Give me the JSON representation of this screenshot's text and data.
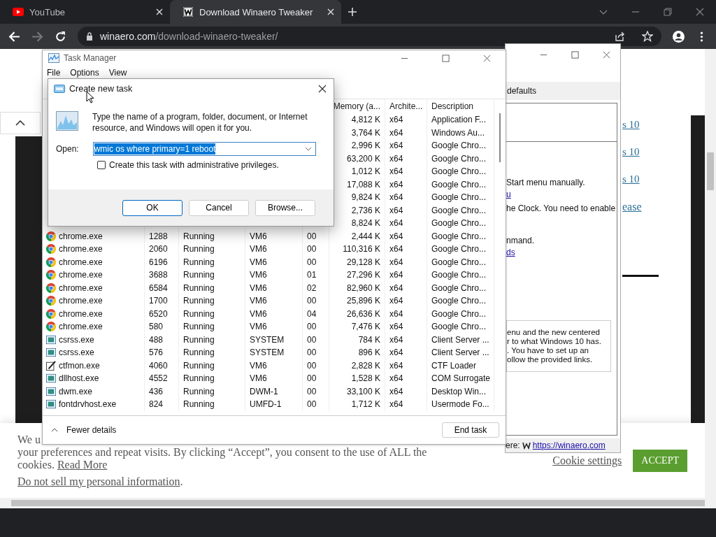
{
  "browser": {
    "tabs": [
      {
        "title": "YouTube",
        "selected": false
      },
      {
        "title": "Download Winaero Tweaker",
        "selected": true
      }
    ],
    "address": {
      "host": "winaero.com",
      "path": "/download-winaero-tweaker/"
    }
  },
  "page": {
    "links": [
      "s 10",
      "s 10",
      "s 10",
      "ease"
    ],
    "cookie_bar": {
      "line_1": "We u",
      "line_2": "your preferences and repeat visits. By clicking “Accept”, you consent to the use of ALL the",
      "line_3": {
        "before": "cookies. ",
        "link": "Read More"
      },
      "line_4": {
        "link": "Do not sell my personal information",
        "after": "."
      },
      "settings": "Cookie settings",
      "accept": "ACCEPT"
    }
  },
  "tweaker_window": {
    "tab": "defaults",
    "lines": [
      {
        "text": "Start menu manually.",
        "kind": "text"
      },
      {
        "text": "u",
        "kind": "link"
      },
      {
        "text": "he Clock. You need to enable",
        "kind": "text"
      },
      {
        "text": "nmand.",
        "kind": "text"
      },
      {
        "text": "ds",
        "kind": "link"
      }
    ],
    "note": [
      "enu and the new centered",
      "r to what Windows 10 has.",
      ". You have to set up an",
      "ollow the provided links."
    ],
    "status": {
      "label": "ere:",
      "link": "https://winaero.com"
    }
  },
  "task_manager": {
    "title": "Task Manager",
    "menu": [
      "File",
      "Options",
      "View"
    ],
    "columns": [
      "Memory (a...",
      "Archite...",
      "Description"
    ],
    "rows": [
      {
        "memory": "4,812 K",
        "arch": "x64",
        "description": "Application F..."
      },
      {
        "memory": "3,764 K",
        "arch": "x64",
        "description": "Windows Au..."
      },
      {
        "memory": "2,996 K",
        "arch": "x64",
        "description": "Google Chro..."
      },
      {
        "memory": "63,200 K",
        "arch": "x64",
        "description": "Google Chro..."
      },
      {
        "memory": "1,012 K",
        "arch": "x64",
        "description": "Google Chro..."
      },
      {
        "memory": "17,088 K",
        "arch": "x64",
        "description": "Google Chro..."
      },
      {
        "memory": "9,824 K",
        "arch": "x64",
        "description": "Google Chro..."
      },
      {
        "memory": "2,736 K",
        "arch": "x64",
        "description": "Google Chro..."
      },
      {
        "memory": "8,824 K",
        "arch": "x64",
        "description": "Google Chro..."
      },
      {
        "kind": "chrome",
        "name": "chrome.exe",
        "pid": "1288",
        "status": "Running",
        "user": "VM6",
        "cpu": "00",
        "memory": "2,444 K",
        "arch": "x64",
        "description": "Google Chro..."
      },
      {
        "kind": "chrome",
        "name": "chrome.exe",
        "pid": "2060",
        "status": "Running",
        "user": "VM6",
        "cpu": "00",
        "memory": "110,316 K",
        "arch": "x64",
        "description": "Google Chro..."
      },
      {
        "kind": "chrome",
        "name": "chrome.exe",
        "pid": "6196",
        "status": "Running",
        "user": "VM6",
        "cpu": "00",
        "memory": "29,128 K",
        "arch": "x64",
        "description": "Google Chro..."
      },
      {
        "kind": "chrome",
        "name": "chrome.exe",
        "pid": "3688",
        "status": "Running",
        "user": "VM6",
        "cpu": "01",
        "memory": "27,296 K",
        "arch": "x64",
        "description": "Google Chro..."
      },
      {
        "kind": "chrome",
        "name": "chrome.exe",
        "pid": "6584",
        "status": "Running",
        "user": "VM6",
        "cpu": "02",
        "memory": "82,960 K",
        "arch": "x64",
        "description": "Google Chro..."
      },
      {
        "kind": "chrome",
        "name": "chrome.exe",
        "pid": "1700",
        "status": "Running",
        "user": "VM6",
        "cpu": "00",
        "memory": "25,896 K",
        "arch": "x64",
        "description": "Google Chro..."
      },
      {
        "kind": "chrome",
        "name": "chrome.exe",
        "pid": "6520",
        "status": "Running",
        "user": "VM6",
        "cpu": "04",
        "memory": "26,636 K",
        "arch": "x64",
        "description": "Google Chro..."
      },
      {
        "kind": "chrome",
        "name": "chrome.exe",
        "pid": "580",
        "status": "Running",
        "user": "VM6",
        "cpu": "00",
        "memory": "7,476 K",
        "arch": "x64",
        "description": "Google Chro..."
      },
      {
        "kind": "app",
        "name": "csrss.exe",
        "pid": "488",
        "status": "Running",
        "user": "SYSTEM",
        "cpu": "00",
        "memory": "784 K",
        "arch": "x64",
        "description": "Client Server ..."
      },
      {
        "kind": "app",
        "name": "csrss.exe",
        "pid": "576",
        "status": "Running",
        "user": "SYSTEM",
        "cpu": "00",
        "memory": "896 K",
        "arch": "x64",
        "description": "Client Server ..."
      },
      {
        "kind": "editor",
        "name": "ctfmon.exe",
        "pid": "4060",
        "status": "Running",
        "user": "VM6",
        "cpu": "00",
        "memory": "2,828 K",
        "arch": "x64",
        "description": "CTF Loader"
      },
      {
        "kind": "app",
        "name": "dllhost.exe",
        "pid": "4552",
        "status": "Running",
        "user": "VM6",
        "cpu": "00",
        "memory": "1,528 K",
        "arch": "x64",
        "description": "COM Surrogate"
      },
      {
        "kind": "app",
        "name": "dwm.exe",
        "pid": "436",
        "status": "Running",
        "user": "DWM-1",
        "cpu": "00",
        "memory": "33,100 K",
        "arch": "x64",
        "description": "Desktop Win..."
      },
      {
        "kind": "app",
        "name": "fontdrvhost.exe",
        "pid": "824",
        "status": "Running",
        "user": "UMFD-1",
        "cpu": "00",
        "memory": "1,712 K",
        "arch": "x64",
        "description": "Usermode Fo..."
      }
    ],
    "fewer_details": "Fewer details",
    "end_task": "End task"
  },
  "dialog": {
    "title": "Create new task",
    "message": "Type the name of a program, folder, document, or Internet resource, and Windows will open it for you.",
    "open_label": "Open:",
    "value": "wmic os where primary=1 reboot",
    "value_selected": true,
    "admin": {
      "label": "Create this task with administrative privileges.",
      "checked": false
    },
    "buttons": [
      {
        "label": "OK",
        "default": true
      },
      {
        "label": "Cancel",
        "default": false
      },
      {
        "label": "Browse...",
        "default": false
      }
    ]
  }
}
